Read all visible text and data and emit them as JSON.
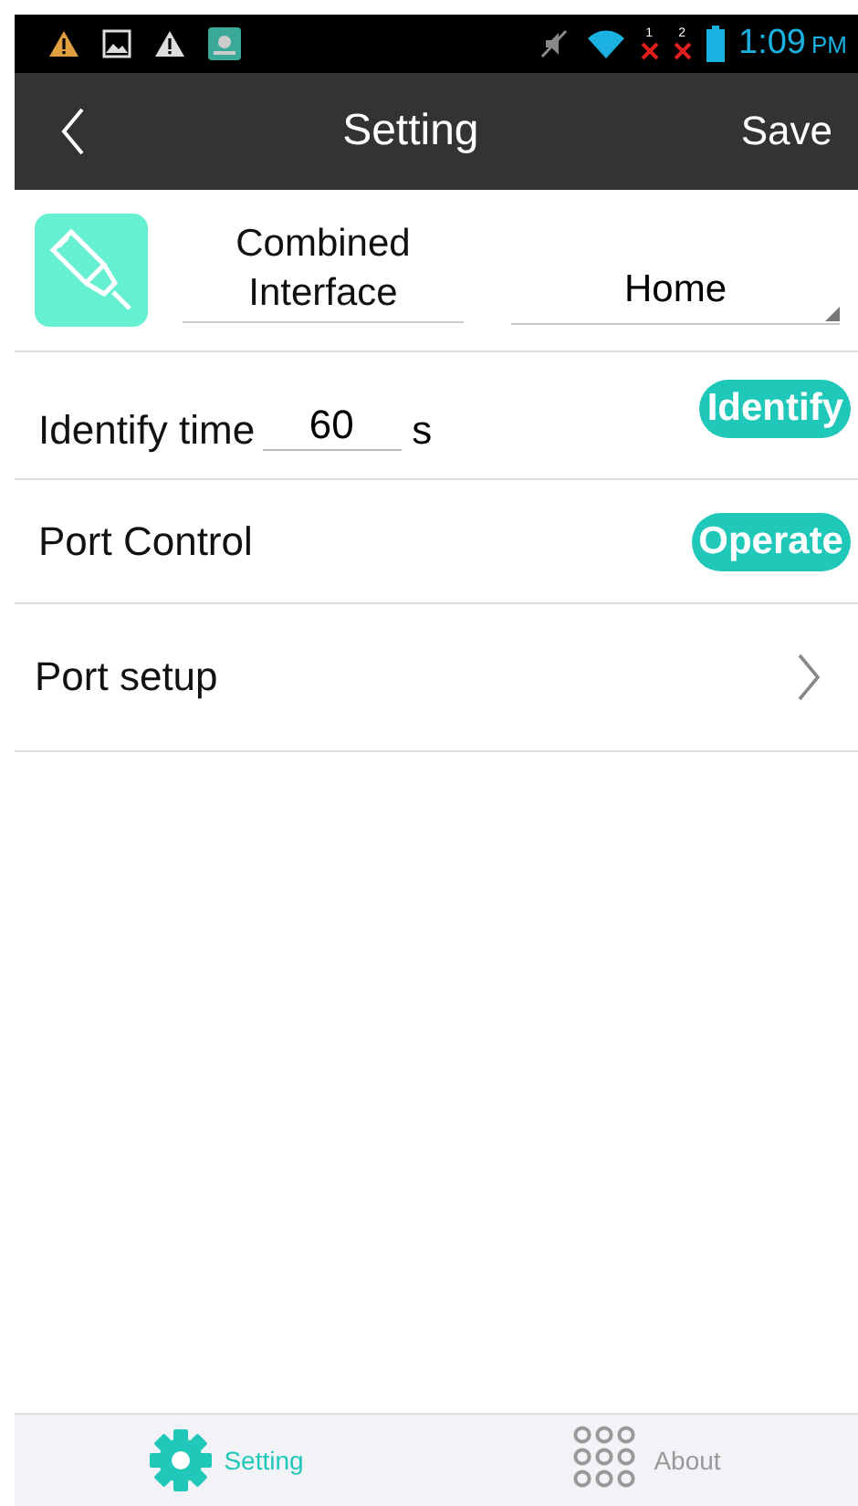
{
  "status_bar": {
    "time": "1:09",
    "ampm": "PM",
    "sim_slots": [
      "1",
      "2"
    ]
  },
  "toolbar": {
    "title": "Setting",
    "action": "Save"
  },
  "device": {
    "name": "Combined Interface",
    "location": "Home"
  },
  "rows": [
    {
      "kind": "input",
      "label": "Identify time",
      "value": "60",
      "unit": "s",
      "button": "Identify"
    },
    {
      "kind": "button",
      "label": "Port Control",
      "button": "Operate"
    },
    {
      "kind": "link",
      "label": "Port setup"
    }
  ],
  "nav": [
    {
      "label": "Setting",
      "kind": "gear",
      "selected": true
    },
    {
      "label": "About",
      "kind": "dots",
      "selected": false
    }
  ]
}
